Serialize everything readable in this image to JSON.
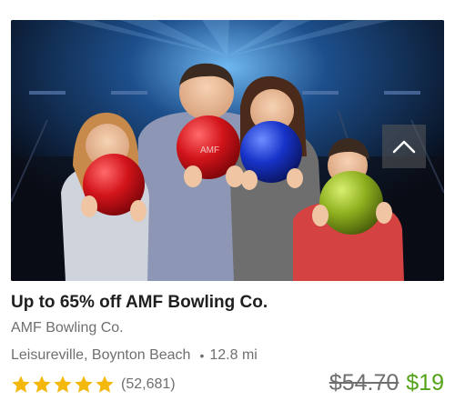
{
  "deal": {
    "title": "Up to 65% off AMF Bowling Co.",
    "merchant": "AMF Bowling Co.",
    "location": "Leisureville, Boynton Beach",
    "distance": "12.8 mi",
    "rating_stars": 5,
    "review_count": "(52,681)",
    "original_price": "$54.70",
    "price": "$19",
    "ball_label": "AMF"
  },
  "icons": {
    "star": "star-icon",
    "collapse": "chevron-up-icon"
  },
  "colors": {
    "price_green": "#53a318",
    "star_gold": "#f4b70b",
    "muted_text": "#6f6f6f",
    "title_text": "#1f1f1f"
  }
}
